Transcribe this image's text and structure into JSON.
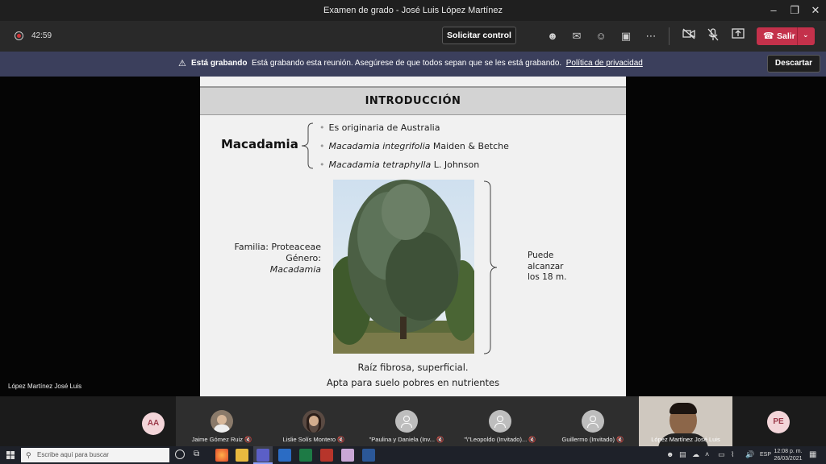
{
  "window": {
    "title": "Examen de grado - José Luis López Martínez"
  },
  "meeting": {
    "timer": "42:59",
    "request_control": "Solicitar control",
    "leave": "Salir"
  },
  "banner": {
    "bold": "Está grabando",
    "message": "Está grabando esta reunión. Asegúrese de que todos sepan que se les está grabando.",
    "link": "Política de privacidad",
    "dismiss": "Descartar"
  },
  "presenter": {
    "label": "López Martínez José Luis"
  },
  "slide": {
    "title": "INTRODUCCIÓN",
    "subject": "Macadamia",
    "bullets": [
      {
        "italic": "",
        "text": "Es originaria de Australia"
      },
      {
        "italic": "Macadamia integrifolia",
        "text": " Maiden & Betche"
      },
      {
        "italic": "Macadamia tetraphylla",
        "text": " L. Johnson"
      }
    ],
    "familia": "Familia: Proteaceae",
    "genero_label": "Género: ",
    "genero_value": "Macadamia",
    "height_note": "Puede alcanzar los 18 m.",
    "bottom_line1": "Raíz fibrosa, superficial.",
    "bottom_line2": "Apta para suelo pobres en nutrientes"
  },
  "participants": [
    {
      "type": "initials",
      "initials": "AA",
      "name": ""
    },
    {
      "type": "photo",
      "name": "Jaime Gómez Ruiz"
    },
    {
      "type": "photo",
      "name": "Lislie Solís Montero"
    },
    {
      "type": "placeholder",
      "name": "\"Paulina y Daniela (Inv..."
    },
    {
      "type": "placeholder",
      "name": "\"\\\"Leopoldo (Invitado)..."
    },
    {
      "type": "placeholder",
      "name": "Guillermo (Invitado)"
    },
    {
      "type": "video",
      "name": "López Martínez José Luis"
    },
    {
      "type": "initials",
      "initials": "PE",
      "name": ""
    }
  ],
  "taskbar": {
    "search_placeholder": "Escribe aquí para buscar",
    "language": "ESP",
    "time": "12:08 p. m.",
    "date": "26/03/2021"
  },
  "colors": {
    "leave": "#c4314b",
    "banner": "#3b3f5c",
    "record": "#d13438"
  }
}
